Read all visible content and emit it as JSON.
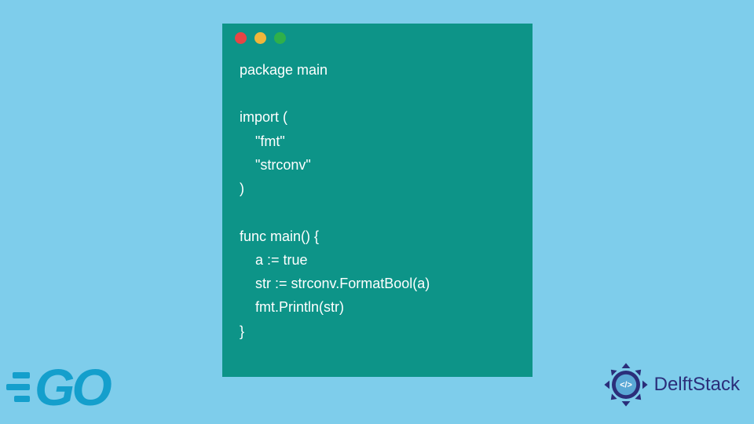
{
  "code": {
    "lines": [
      "package main",
      "",
      "import (",
      "    \"fmt\"",
      "    \"strconv\"",
      ")",
      "",
      "func main() {",
      "    a := true",
      "    str := strconv.FormatBool(a)",
      "    fmt.Println(str)",
      "}"
    ]
  },
  "go_logo": {
    "text": "GO"
  },
  "delft_logo": {
    "text": "DelftStack",
    "glyph": "</>"
  },
  "colors": {
    "bg": "#7ecdeb",
    "window": "#0d9488",
    "go": "#149fcc",
    "delft": "#2b2e7a"
  }
}
